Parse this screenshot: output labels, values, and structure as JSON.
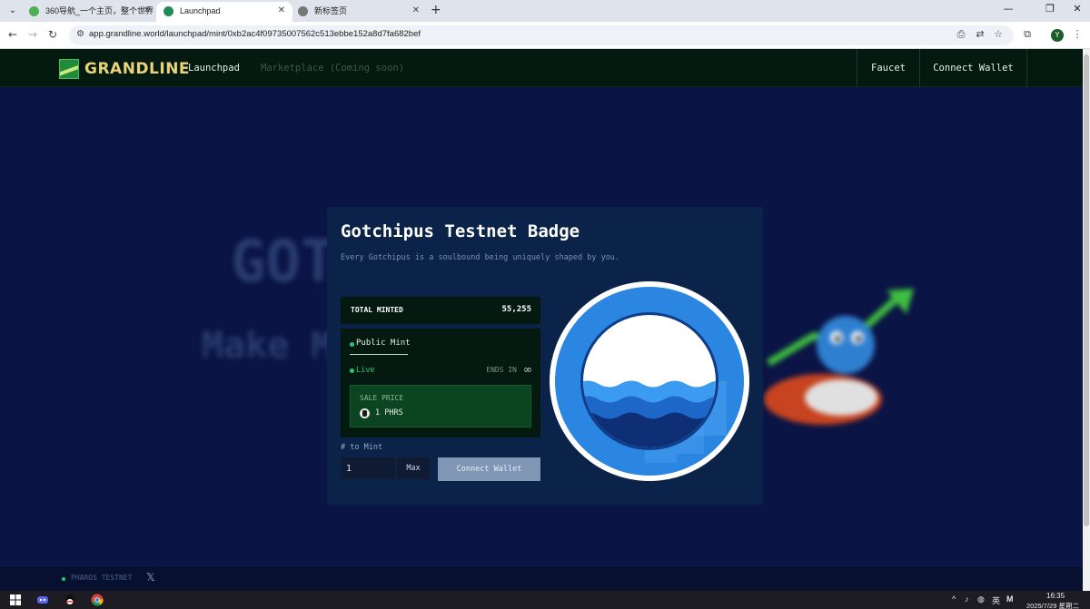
{
  "browser": {
    "tabs": [
      {
        "title": "360导航_一个主页，整个世界",
        "favicon_color": "#4caf50"
      },
      {
        "title": "Launchpad",
        "favicon_color": "#1f8b5b"
      },
      {
        "title": "新标签页",
        "favicon_color": "#777777"
      }
    ],
    "active_tab": 1,
    "url": "app.grandline.world/launchpad/mint/0xb2ac4f09735007562c513ebbe152a8d7fa682bef",
    "profile_initial": "Y"
  },
  "header": {
    "logo": "GRANDLINE",
    "nav": [
      {
        "label": "Launchpad",
        "enabled": true
      },
      {
        "label": "Marketplace (Coming soon)",
        "enabled": false
      }
    ],
    "faucet_label": "Faucet",
    "connect_label": "Connect Wallet"
  },
  "hero_background": {
    "line1": "GOTCHIPUS",
    "line2": "Make M"
  },
  "card": {
    "title": "Gotchipus Testnet Badge",
    "subtitle": "Every Gotchipus is a soulbound being uniquely shaped by you.",
    "total_minted_label": "TOTAL MINTED",
    "total_minted_value": "55,255",
    "phase_name": "Public Mint",
    "status": "Live",
    "ends_label": "ENDS IN",
    "ends_value": "∞",
    "sale_price_label": "SALE PRICE",
    "sale_price_value": "1 PHRS",
    "qty_label": "# to Mint",
    "qty_value": "1",
    "max_label": "Max",
    "connect_label": "Connect Wallet"
  },
  "footer": {
    "network": "PHAROS TESTNET",
    "social_icon": "x-icon"
  },
  "taskbar": {
    "ime_label": "英",
    "ime_mode": "M",
    "time": "16:35",
    "date": "2025/7/29 星期二"
  },
  "colors": {
    "accent_green": "#28c76f",
    "page_bg": "#0a1445",
    "header_bg": "#041a10",
    "logo_gold": "#e8d37a"
  }
}
